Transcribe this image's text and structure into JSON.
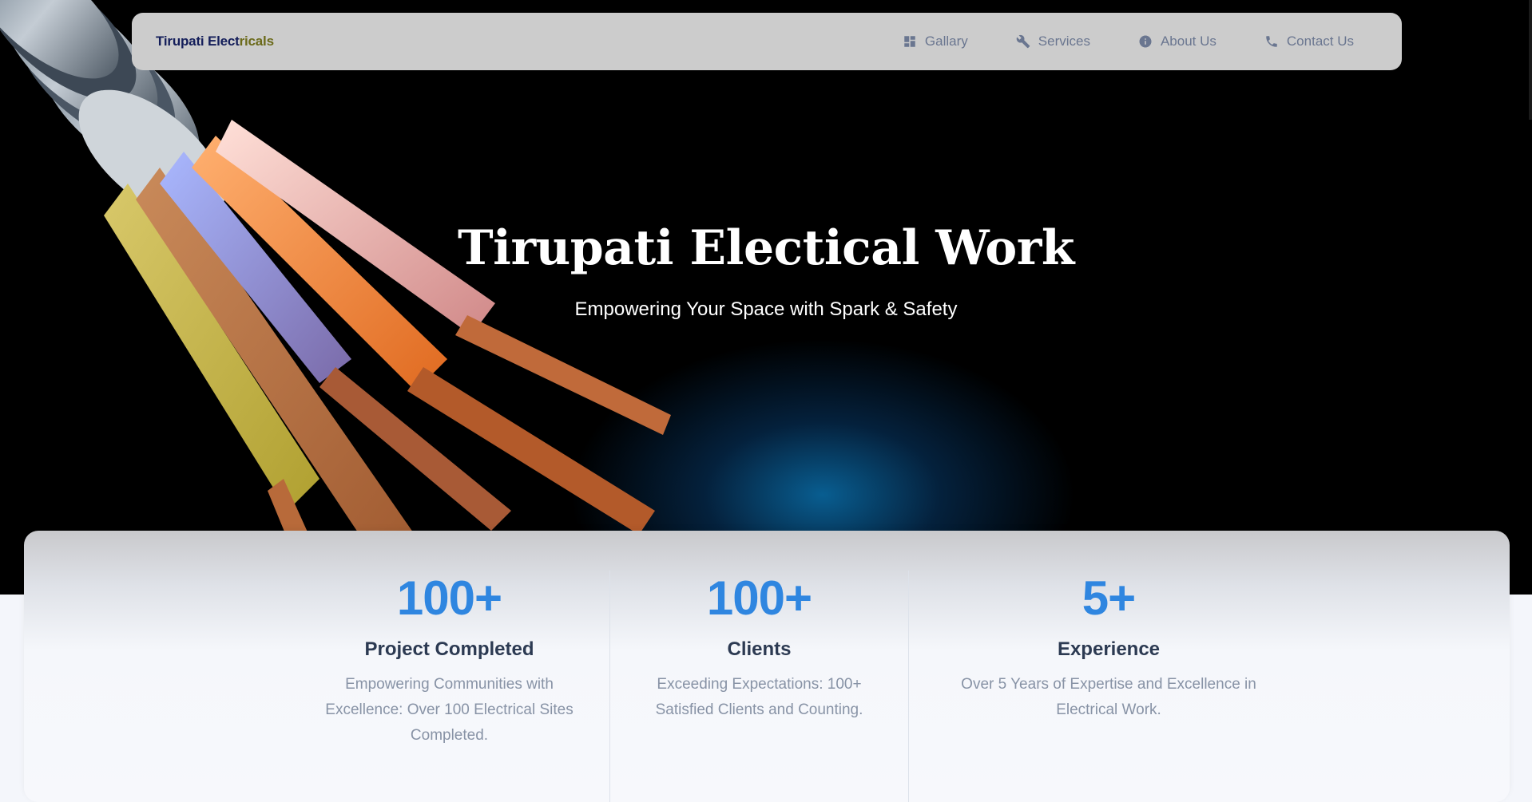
{
  "brand": {
    "part1": "Tirupati Elect",
    "part2": "ricals"
  },
  "nav": {
    "items": [
      {
        "label": "Gallary",
        "icon": "dashboard-icon"
      },
      {
        "label": "Services",
        "icon": "wrench-icon"
      },
      {
        "label": "About Us",
        "icon": "info-icon"
      },
      {
        "label": "Contact Us",
        "icon": "phone-icon"
      }
    ]
  },
  "hero": {
    "title": "Tirupati Electical Work",
    "subtitle": "Empowering Your Space with Spark & Safety"
  },
  "stats": [
    {
      "value": "100+",
      "title": "Project Completed",
      "desc": "Empowering Communities with Excellence: Over 100 Electrical Sites Completed."
    },
    {
      "value": "100+",
      "title": "Clients",
      "desc": "Exceeding Expectations: 100+ Satisfied Clients and Counting."
    },
    {
      "value": "5+",
      "title": "Experience",
      "desc": "Over 5 Years of Expertise and Excellence in Electrical Work."
    }
  ],
  "colors": {
    "accent": "#2f86e0",
    "navbar": "#cccccc",
    "hero_bg": "#000000"
  }
}
